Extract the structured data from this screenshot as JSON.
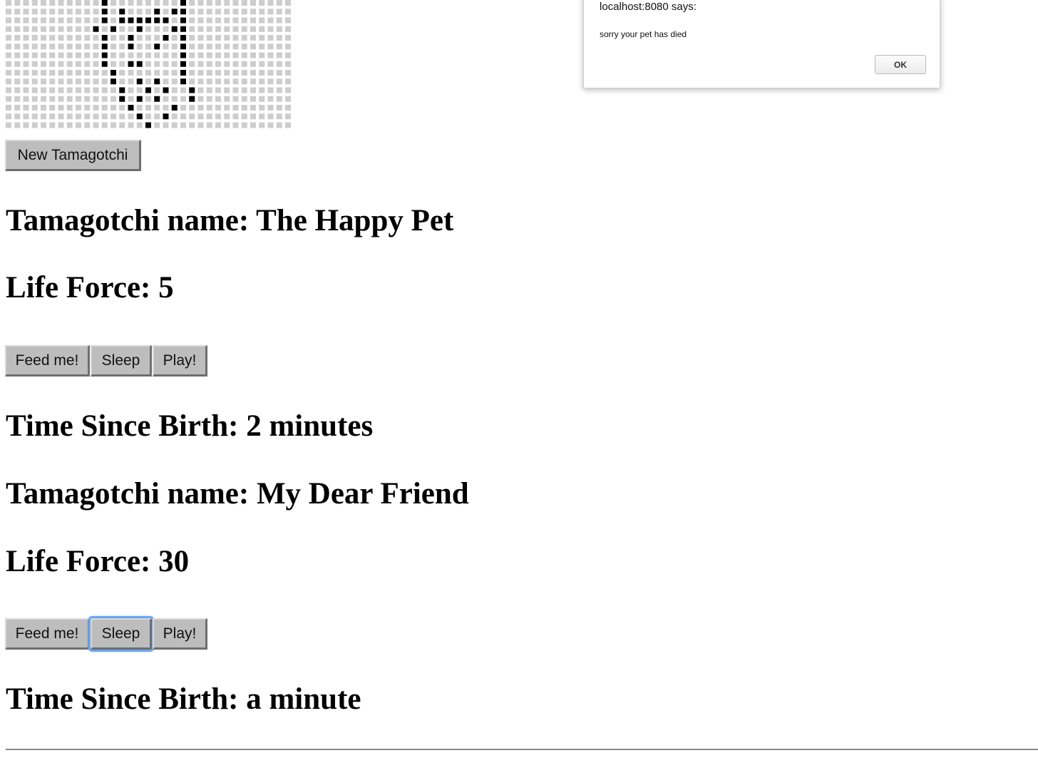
{
  "app": {
    "new_button_label": "New Tamagotchi"
  },
  "pets": [
    {
      "name_heading": "Tamagotchi name: The Happy Pet",
      "life_force_heading": "Life Force: 5",
      "actions": [
        "Feed me!",
        "Sleep",
        "Play!"
      ],
      "time_heading": "Time Since Birth: 2 minutes"
    },
    {
      "name_heading": "Tamagotchi name: My Dear Friend",
      "life_force_heading": "Life Force: 30",
      "actions": [
        "Feed me!",
        "Sleep",
        "Play!"
      ],
      "time_heading": "Time Since Birth: a minute"
    }
  ],
  "dialog": {
    "title": "localhost:8080 says:",
    "message": "sorry your pet has died",
    "ok_label": "OK"
  },
  "colors": {
    "grid_off": "#cdcdcd",
    "grid_on": "#000000",
    "button_face": "#bdbdbd",
    "focus_ring": "#6aa5f0"
  },
  "sprite": {
    "columns": 33,
    "rows": 15,
    "on_cells": [
      [
        0,
        11
      ],
      [
        0,
        20
      ],
      [
        1,
        11
      ],
      [
        1,
        13
      ],
      [
        1,
        17
      ],
      [
        1,
        19
      ],
      [
        1,
        20
      ],
      [
        2,
        11
      ],
      [
        2,
        13
      ],
      [
        2,
        14
      ],
      [
        2,
        15
      ],
      [
        2,
        16
      ],
      [
        2,
        17
      ],
      [
        2,
        18
      ],
      [
        2,
        20
      ],
      [
        3,
        10
      ],
      [
        3,
        12
      ],
      [
        3,
        15
      ],
      [
        3,
        19
      ],
      [
        3,
        20
      ],
      [
        4,
        11
      ],
      [
        4,
        14
      ],
      [
        4,
        18
      ],
      [
        4,
        20
      ],
      [
        5,
        11
      ],
      [
        5,
        14
      ],
      [
        5,
        17
      ],
      [
        5,
        20
      ],
      [
        6,
        11
      ],
      [
        6,
        20
      ],
      [
        7,
        11
      ],
      [
        7,
        14
      ],
      [
        7,
        15
      ],
      [
        7,
        20
      ],
      [
        8,
        12
      ],
      [
        8,
        20
      ],
      [
        9,
        12
      ],
      [
        9,
        15
      ],
      [
        9,
        17
      ],
      [
        9,
        20
      ],
      [
        10,
        13
      ],
      [
        10,
        16
      ],
      [
        10,
        18
      ],
      [
        10,
        21
      ],
      [
        11,
        13
      ],
      [
        11,
        15
      ],
      [
        11,
        17
      ],
      [
        11,
        21
      ],
      [
        12,
        14
      ],
      [
        12,
        19
      ],
      [
        13,
        15
      ],
      [
        13,
        18
      ],
      [
        14,
        16
      ]
    ]
  }
}
